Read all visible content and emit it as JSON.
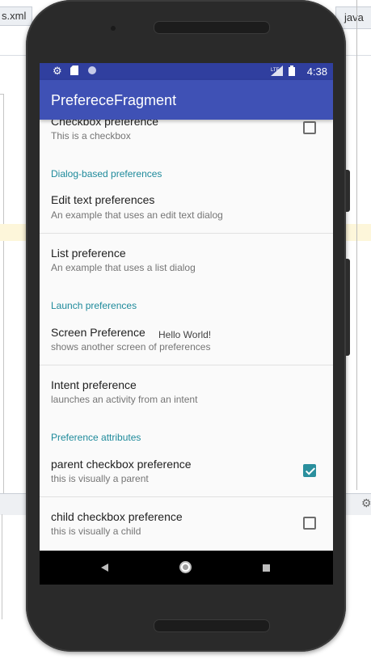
{
  "ide": {
    "tab_left": "s.xml",
    "tab_right": "java"
  },
  "status_bar": {
    "time": "4:38",
    "icons": [
      "gear-icon",
      "sd-card-icon",
      "circle-icon",
      "signal-icon",
      "battery-icon"
    ]
  },
  "app_bar": {
    "title": "PrefereceFragment"
  },
  "preferences": {
    "checkbox_pref": {
      "title": "Checkbox preference",
      "summary": "This is a checkbox",
      "checked": false
    },
    "section_dialog": "Dialog-based preferences",
    "edit_text": {
      "title": "Edit text preferences",
      "summary": "An example that uses an edit text dialog"
    },
    "list_pref": {
      "title": "List preference",
      "summary": "An example that uses a list dialog"
    },
    "section_launch": "Launch preferences",
    "screen_pref": {
      "title": "Screen Preference",
      "summary": "shows another screen of preferences"
    },
    "hello": "Hello World!",
    "intent_pref": {
      "title": "Intent preference",
      "summary": "launches an activity from an intent"
    },
    "section_attributes": "Preference attributes",
    "parent_checkbox": {
      "title": "parent checkbox preference",
      "summary": "this is visually a parent",
      "checked": true
    },
    "child_checkbox": {
      "title": "child checkbox preference",
      "summary": "this is visually a child",
      "checked": false
    }
  },
  "colors": {
    "status_bar": "#303f9f",
    "app_bar": "#3f51b5",
    "accent": "#2a8f9d",
    "section_header": "#1e8a9b"
  },
  "nav_bar": {
    "icons": [
      "back-icon",
      "home-icon",
      "recents-icon"
    ]
  }
}
